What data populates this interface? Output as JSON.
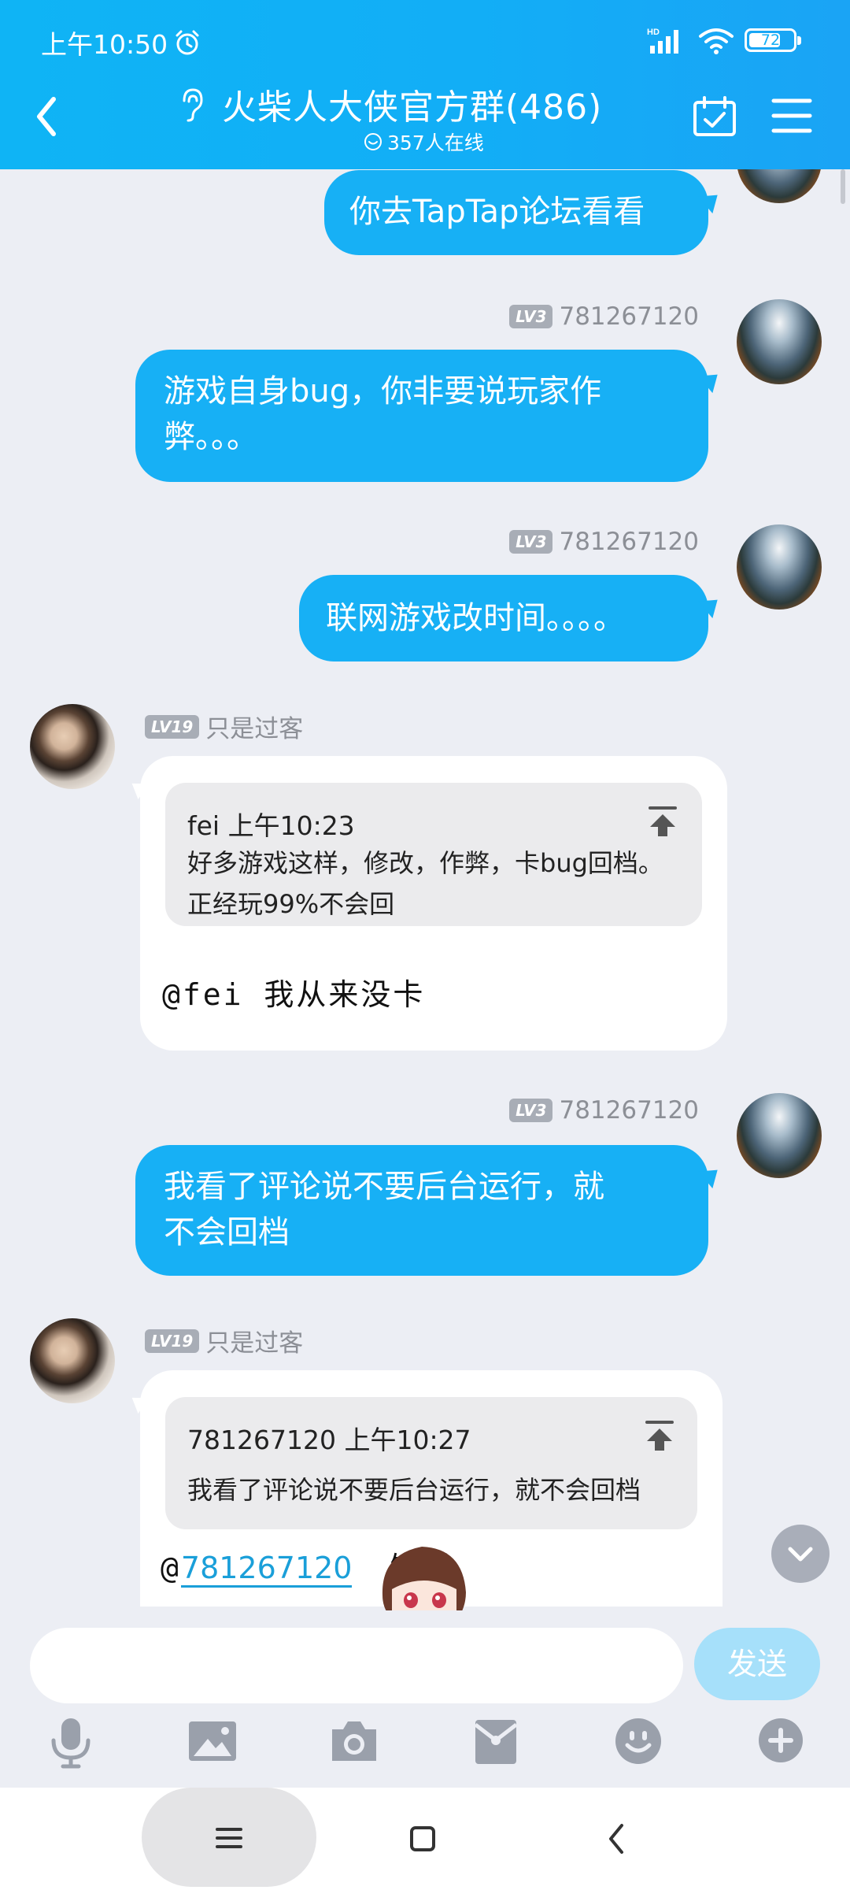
{
  "status_bar": {
    "time": "上午10:50",
    "network": "HD",
    "battery": "72",
    "battery_level": 0.72
  },
  "header": {
    "title": "火柴人大侠官方群(486)",
    "online": "357人在线"
  },
  "messages": [
    {
      "id": "m0",
      "side": "right",
      "text": "你去TapTap论坛看看"
    },
    {
      "id": "m1",
      "side": "right",
      "level": "LV3",
      "sender": "781267120",
      "text_line1": "游戏自身bug，你非要说玩家作",
      "text_line2": "弊。。。"
    },
    {
      "id": "m2",
      "side": "right",
      "level": "LV3",
      "sender": "781267120",
      "text": "联网游戏改时间。。。。"
    },
    {
      "id": "m3",
      "side": "left",
      "level": "LV19",
      "sender": "只是过客",
      "quote": {
        "author_time": "fei 上午10:23",
        "line1": "好多游戏这样，修改，作弊，卡bug回档。",
        "line2": "正经玩99%不会回"
      },
      "reply": "@fei 我从来没卡"
    },
    {
      "id": "m4",
      "side": "right",
      "level": "LV3",
      "sender": "781267120",
      "text_line1": "我看了评论说不要后台运行，就",
      "text_line2": "不会回档"
    },
    {
      "id": "m5",
      "side": "left",
      "level": "LV19",
      "sender": "只是过客",
      "quote": {
        "author_time": "781267120 上午10:27",
        "line1": "我看了评论说不要后台运行，就不会回档"
      },
      "reply_at": "@",
      "reply_mention": "781267120",
      "reply_tail": "知道"
    }
  ],
  "input": {
    "placeholder": "",
    "send_label": "发送"
  },
  "toolbar": [
    "microphone-icon",
    "image-icon",
    "camera-icon",
    "red-packet-icon",
    "emoji-icon",
    "plus-icon"
  ],
  "colors": {
    "accent": "#17b0f5",
    "background": "#eceef4",
    "link": "#1a9fd9"
  }
}
